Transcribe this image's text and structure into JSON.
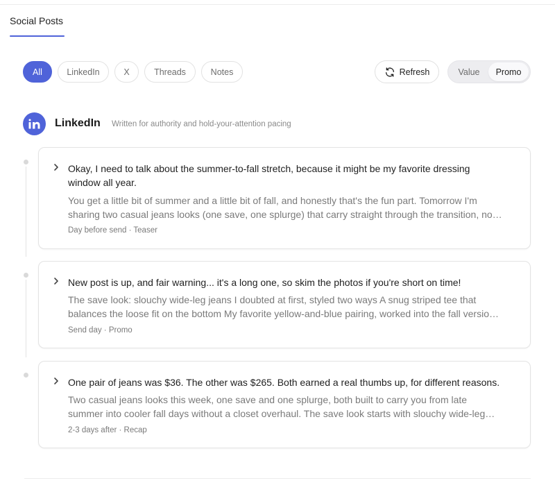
{
  "header": {
    "tab_label": "Social Posts"
  },
  "filters": {
    "chips": [
      {
        "label": "All",
        "active": true
      },
      {
        "label": "LinkedIn",
        "active": false
      },
      {
        "label": "X",
        "active": false
      },
      {
        "label": "Threads",
        "active": false
      },
      {
        "label": "Notes",
        "active": false
      }
    ],
    "refresh_label": "Refresh",
    "refresh_icon": "refresh-icon",
    "mode_options": [
      {
        "label": "Value",
        "selected": false
      },
      {
        "label": "Promo",
        "selected": true
      }
    ]
  },
  "platform": {
    "name": "LinkedIn",
    "description": "Written for authority and hold-your-attention pacing",
    "icon": "linkedin-icon",
    "accent_color": "#4f63d9"
  },
  "posts": [
    {
      "hook_lines": [
        "Okay, I need to talk about the summer-to-fall stretch, because it might be my favorite dressing",
        "window all year."
      ],
      "body_lines": [
        "You get a little bit of summer and a little bit of fall, and honestly that's the fun part. Tomorrow I'm",
        "sharing two casual jeans looks (one save, one splurge) that carry straight through the transition, no…"
      ],
      "meta": "Day before send · Teaser"
    },
    {
      "hook_lines": [
        "New post is up, and fair warning... it's a long one, so skim the photos if you're short on time!"
      ],
      "body_lines": [
        "The save look: slouchy wide-leg jeans I doubted at first, styled two ways A snug striped tee that",
        "balances the loose fit on the bottom My favorite yellow-and-blue pairing, worked into the fall versio…"
      ],
      "meta": "Send day · Promo"
    },
    {
      "hook_lines": [
        "One pair of jeans was $36. The other was $265. Both earned a real thumbs up, for different reasons."
      ],
      "body_lines": [
        "Two casual jeans looks this week, one save and one splurge, both built to carry you from late",
        "summer into cooler fall days without a closet overhaul. The save look starts with slouchy wide-leg…"
      ],
      "meta": "2-3 days after · Recap"
    }
  ]
}
